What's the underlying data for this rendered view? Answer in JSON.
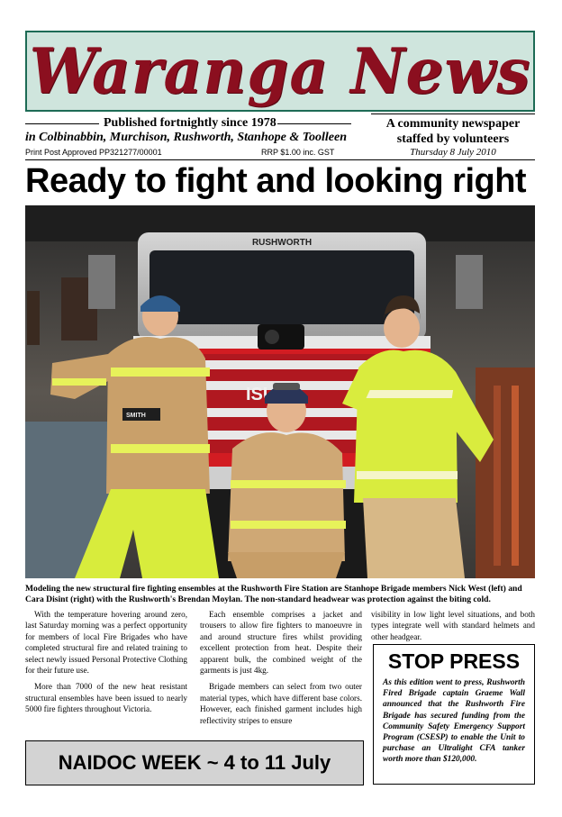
{
  "masthead": {
    "title": "Waranga News"
  },
  "header": {
    "tagline": "Published fortnightly since 1978",
    "towns": "in Colbinabbin, Murchison, Rushworth, Stanhope & Toolleen",
    "post_approved": "Print Post Approved PP321277/00001",
    "rrp": "RRP $1.00 inc. GST",
    "community_line1": "A community newspaper",
    "community_line2": "staffed by volunteers",
    "date": "Thursday 8 July 2010"
  },
  "headline": "Ready to fight and looking right",
  "photo": {
    "truck_label": "RUSHWORTH",
    "truck_brand": "ISUZU",
    "name_tag": "SMITH"
  },
  "caption": "Modeling the new structural fire fighting ensembles at the Rushworth Fire Station are Stanhope Brigade members Nick West (left) and Cara Disint (right) with the Rushworth's Brendan Moylan. The non-standard headwear was protection against the biting cold.",
  "article": {
    "col1_p1": "With the temperature hovering around zero, last Saturday morning was a perfect opportunity for members of local Fire Brigades who have completed structural fire and related training to select newly issued Personal Protective Clothing for their future use.",
    "col1_p2": "More than 7000 of the new heat resistant structural ensembles have been issued to nearly 5000 fire fighters throughout Victoria.",
    "col2_p1": "Each ensemble comprises a jacket and trousers to allow fire fighters to manoeuvre in and around structure fires whilst providing excellent protection from heat. Despite their apparent bulk, the combined weight of the garments is just 4kg.",
    "col2_p2": "Brigade members can select from two outer material types, which have different base colors. However, each finished garment includes high reflectivity stripes to ensure",
    "col3_p1": "visibility in low light level situations, and both types integrate well with standard helmets and other headgear."
  },
  "stop_press": {
    "title": "STOP PRESS",
    "body": "As this edition went to press, Rushworth Fired Brigade captain Graeme Wall announced that the Rushworth Fire Brigade has secured funding from the Community Safety Emergency Support Program (CSESP) to enable the Unit to purchase an Ultralight CFA tanker worth more than $120,000."
  },
  "naidoc": "NAIDOC WEEK ~ 4 to 11 July"
}
